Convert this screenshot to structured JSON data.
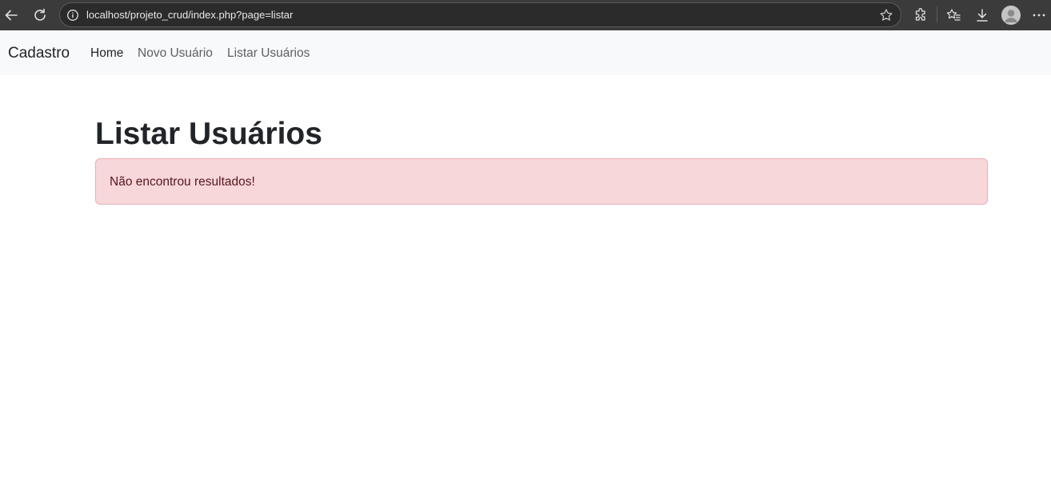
{
  "browser": {
    "url": "localhost/projeto_crud/index.php?page=listar",
    "icons": [
      "back-arrow-icon",
      "refresh-icon",
      "info-icon",
      "star-icon",
      "extensions-icon",
      "favorites-icon",
      "download-icon",
      "profile-avatar",
      "more-icon"
    ]
  },
  "navbar": {
    "brand": "Cadastro",
    "links": [
      {
        "label": "Home",
        "active": true
      },
      {
        "label": "Novo Usuário",
        "active": false
      },
      {
        "label": "Listar Usuários",
        "active": false
      }
    ]
  },
  "main": {
    "title": "Listar Usuários",
    "alert": "Não encontrou resultados!"
  },
  "colors": {
    "alert_bg": "#f8d7da",
    "alert_border": "#f1aeb5",
    "alert_text": "#58151c",
    "navbar_bg": "#f8f9fa"
  }
}
